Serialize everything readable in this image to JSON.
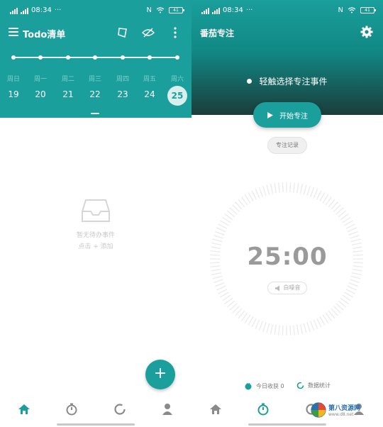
{
  "status_bar": {
    "time": "08:34",
    "dots": "···",
    "battery": "41"
  },
  "todo": {
    "title": "Todo清单",
    "weekdays": [
      "周日",
      "周一",
      "周二",
      "周三",
      "周四",
      "周五",
      "周六"
    ],
    "days": [
      "19",
      "20",
      "21",
      "22",
      "23",
      "24",
      "25"
    ],
    "selected_day": "25",
    "empty_line1": "暂无待办事件",
    "empty_line2": "点击 + 添加",
    "fab_label": "+"
  },
  "focus": {
    "title": "番茄专注",
    "select_event": "轻触选择专注事件",
    "start_button": "开始专注",
    "records_button": "专注记录",
    "timer": "25:00",
    "white_noise": "白噪音",
    "today_harvest": "今日收获 0",
    "data_stats": "数据统计"
  },
  "watermark": {
    "text": "第八资源网",
    "url": "www.d8.net"
  },
  "colors": {
    "accent": "#1a9f9c",
    "accent_light": "#d9efee"
  },
  "icons": [
    "menu-icon",
    "flip-icon",
    "eye-off-icon",
    "more-vert-icon",
    "gear-icon",
    "inbox-icon",
    "play-icon",
    "speaker-icon",
    "home-icon",
    "timer-icon",
    "progress-ring-icon",
    "person-icon"
  ]
}
